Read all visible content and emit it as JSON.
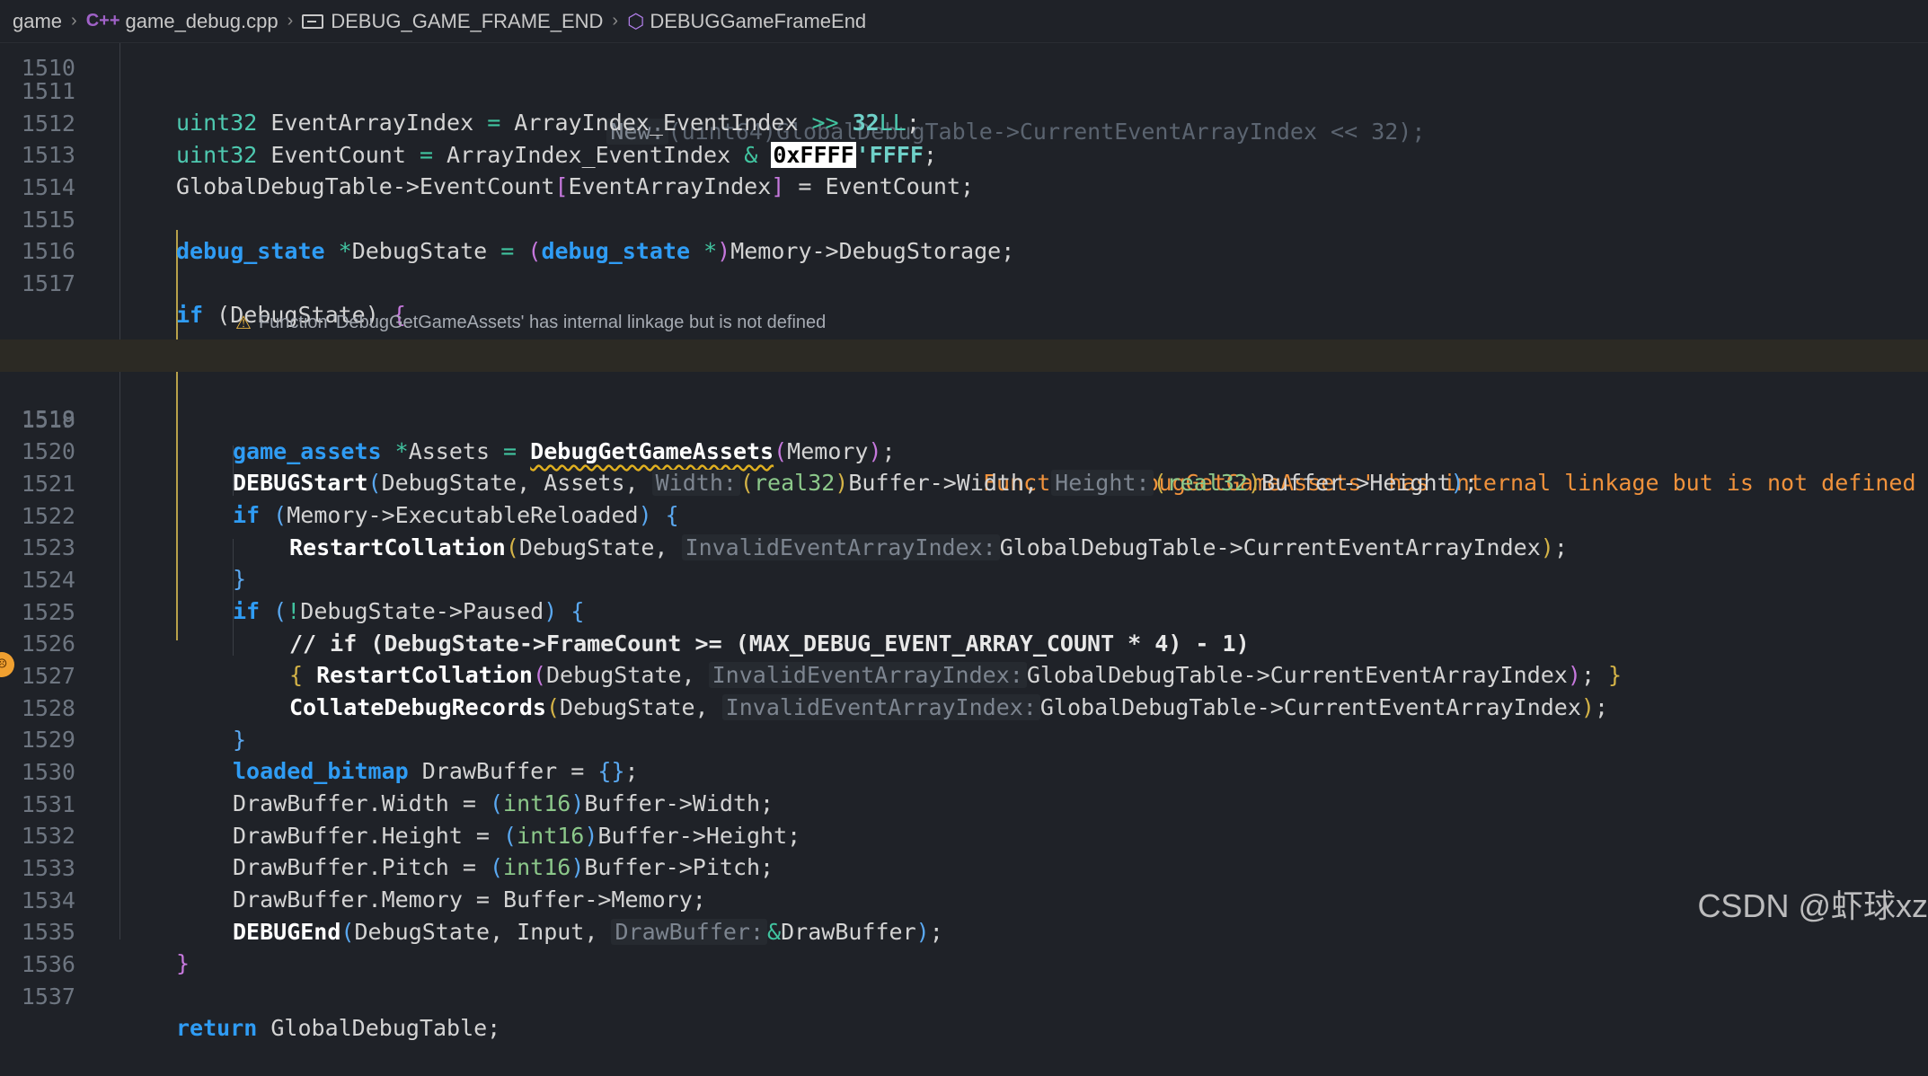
{
  "breadcrumb": {
    "root": "game",
    "file": "game_debug.cpp",
    "macro": "DEBUG_GAME_FRAME_END",
    "func": "DEBUGGameFrameEnd"
  },
  "line_numbers": [
    "1510",
    "1511",
    "1512",
    "1513",
    "1514",
    "1515",
    "1516",
    "1517",
    "1518",
    "1519",
    "1520",
    "1521",
    "1522",
    "1523",
    "1524",
    "1525",
    "1526",
    "1527",
    "1528",
    "1529",
    "1530",
    "1531",
    "1532",
    "1533",
    "1534",
    "1535",
    "1536",
    "1537"
  ],
  "code": {
    "l1510": {
      "hint": "New:",
      "rest": "(uint64)GlobalDebugTable->CurrentEventArrayIndex << 32);"
    },
    "l1511": {
      "type": "uint32",
      "a": " EventArrayIndex ",
      "eq": "=",
      "b": " ArrayIndex_EventIndex ",
      "shr": ">>",
      "num": " 32",
      "suf": "LL",
      "end": ";"
    },
    "l1512": {
      "type": "uint32",
      "a": " EventCount ",
      "eq": "=",
      "b": " ArrayIndex_EventIndex ",
      "amp": "&",
      "hex": "0xFFFF",
      "hex2": "'FFFF",
      "end": ";"
    },
    "l1513": {
      "a": "GlobalDebugTable->EventCount",
      "lb": "[",
      "b": "EventArrayIndex",
      "rb": "]",
      "c": " = EventCount;"
    },
    "l1515": {
      "kw": "debug_state",
      "star": " *",
      "a": "DebugState ",
      "eq": "=",
      "lp": " (",
      "kw2": "debug_state",
      "star2": " *",
      "rp": ")",
      "b": "Memory->DebugStorage;"
    },
    "l1517": {
      "kw": "if",
      "a": " (DebugState) ",
      "brace": "{"
    },
    "hover_warning": "Function 'DebugGetGameAssets' has internal linkage but is not defined",
    "l1518": {
      "kw": "game_assets",
      "star": " *",
      "a": "Assets ",
      "eq": "=",
      "fn": "DebugGetGameAssets",
      "lp": "(",
      "arg": "Memory",
      "rp": ")",
      "end": ";",
      "err": "Function 'DebugGetGameAssets' has internal linkage but is not defined"
    },
    "l1520": {
      "fn": "DEBUGStart",
      "lp": "(",
      "a": "DebugState, Assets, ",
      "h1": "Width:",
      "c1": "(",
      "t1": "real32",
      "c2": ")",
      "b": "Buffer->Width, ",
      "h2": "Height:",
      "c3": "(",
      "t2": "real32",
      "c4": ")",
      "c": "Buffer->Height",
      "rp": ")",
      "end": ";"
    },
    "l1521": {
      "kw": "if",
      "lp": " (",
      "a": "Memory->ExecutableReloaded",
      "rp": ")",
      "brace": " {"
    },
    "l1522": {
      "fn": "RestartCollation",
      "lp": "(",
      "a": "DebugState, ",
      "h": "InvalidEventArrayIndex:",
      "b": "GlobalDebugTable->CurrentEventArrayIndex",
      "rp": ")",
      "end": ";"
    },
    "l1523": {
      "brace": "}"
    },
    "l1524": {
      "kw": "if",
      "lp": " (",
      "not": "!",
      "a": "DebugState->Paused",
      "rp": ")",
      "brace": " {"
    },
    "l1525": {
      "cmt": "// if (DebugState->FrameCount >= (MAX_DEBUG_EVENT_ARRAY_COUNT * 4) - 1)"
    },
    "l1526": {
      "lb": "{ ",
      "fn": "RestartCollation",
      "lp": "(",
      "a": "DebugState, ",
      "h": "InvalidEventArrayIndex:",
      "b": "GlobalDebugTable->CurrentEventArrayIndex",
      "rp": ")",
      "end": "; ",
      "rb": "}"
    },
    "l1527": {
      "fn": "CollateDebugRecords",
      "lp": "(",
      "a": "DebugState, ",
      "h": "InvalidEventArrayIndex:",
      "b": "GlobalDebugTable->CurrentEventArrayIndex",
      "rp": ")",
      "end": ";"
    },
    "l1528": {
      "brace": "}"
    },
    "l1529": {
      "kw": "loaded_bitmap",
      "a": " DrawBuffer = ",
      "br": "{}",
      "end": ";"
    },
    "l1530": {
      "a": "DrawBuffer.Width = ",
      "lp": "(",
      "t": "int16",
      "rp": ")",
      "b": "Buffer->Width;"
    },
    "l1531": {
      "a": "DrawBuffer.Height = ",
      "lp": "(",
      "t": "int16",
      "rp": ")",
      "b": "Buffer->Height;"
    },
    "l1532": {
      "a": "DrawBuffer.Pitch = ",
      "lp": "(",
      "t": "int16",
      "rp": ")",
      "b": "Buffer->Pitch;"
    },
    "l1533": {
      "a": "DrawBuffer.Memory = Buffer->Memory;"
    },
    "l1534": {
      "fn": "DEBUGEnd",
      "lp": "(",
      "a": "DebugState, Input, ",
      "h": "DrawBuffer:",
      "amp": "&",
      "b": "DrawBuffer",
      "rp": ")",
      "end": ";"
    },
    "l1535": {
      "brace": "}"
    },
    "l1537": {
      "kw": "return",
      "a": " GlobalDebugTable;"
    }
  },
  "watermark": "CSDN @虾球xz",
  "colors": {
    "keyword": "#2f9cf4",
    "type": "#4ec9b0",
    "warning": "#f0923c",
    "background": "#1f2228"
  }
}
